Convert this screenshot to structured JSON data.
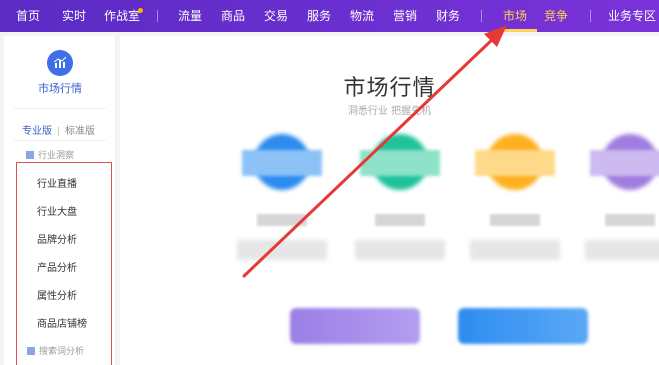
{
  "topnav": {
    "items": [
      "首页",
      "实时",
      "作战室",
      "流量",
      "商品",
      "交易",
      "服务",
      "物流",
      "营销",
      "财务",
      "市场",
      "竞争",
      "业务专区"
    ],
    "active": "市场"
  },
  "sidebar": {
    "title": "市场行情",
    "tab_pro": "专业版",
    "tab_std": "标准版",
    "section1": "行业洞察",
    "menu": [
      "行业直播",
      "行业大盘",
      "品牌分析",
      "产品分析",
      "属性分析",
      "商品店铺榜"
    ],
    "section2": "搜索词分析"
  },
  "main": {
    "title": "市场行情",
    "subtitle": "洞悉行业 把握先机"
  },
  "colors": {
    "nav_bg": "#6b2fd0",
    "active_nav": "#ffd25a",
    "accent_blue": "#3a5fcd",
    "arrow_red": "#e53935",
    "card_blue": "#2d8cf0",
    "card_green": "#1fc39a",
    "card_orange": "#ffb020",
    "card_purple": "#a07ee0"
  },
  "icons": [
    "chart-logo-icon",
    "section-icon",
    "red-arrow-annotation"
  ]
}
